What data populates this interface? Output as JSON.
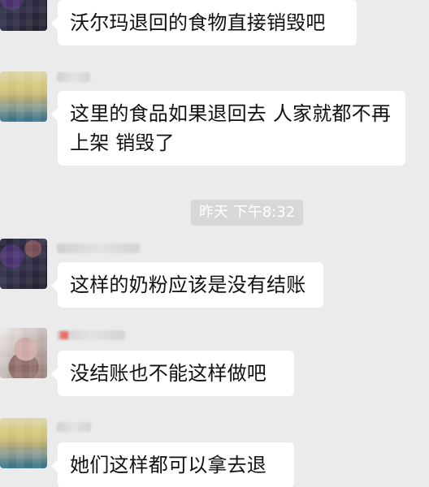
{
  "chat": {
    "timestamp": "昨天 下午8:32",
    "messages": [
      {
        "text": "沃尔玛退回的食物直接销毁吧"
      },
      {
        "text": "这里的食品如果退回去 人家就都不再上架 销毁了"
      },
      {
        "text": "这样的奶粉应该是没有结账"
      },
      {
        "text": "没结账也不能这样做吧"
      },
      {
        "text": "她们这样都可以拿去退"
      }
    ]
  },
  "colors": {
    "background": "#ebebeb",
    "bubble": "#ffffff",
    "timestamp_bg": "#d7d7d7",
    "timestamp_text": "#ffffff",
    "name_blur_red_accent": "#ea5a50"
  }
}
